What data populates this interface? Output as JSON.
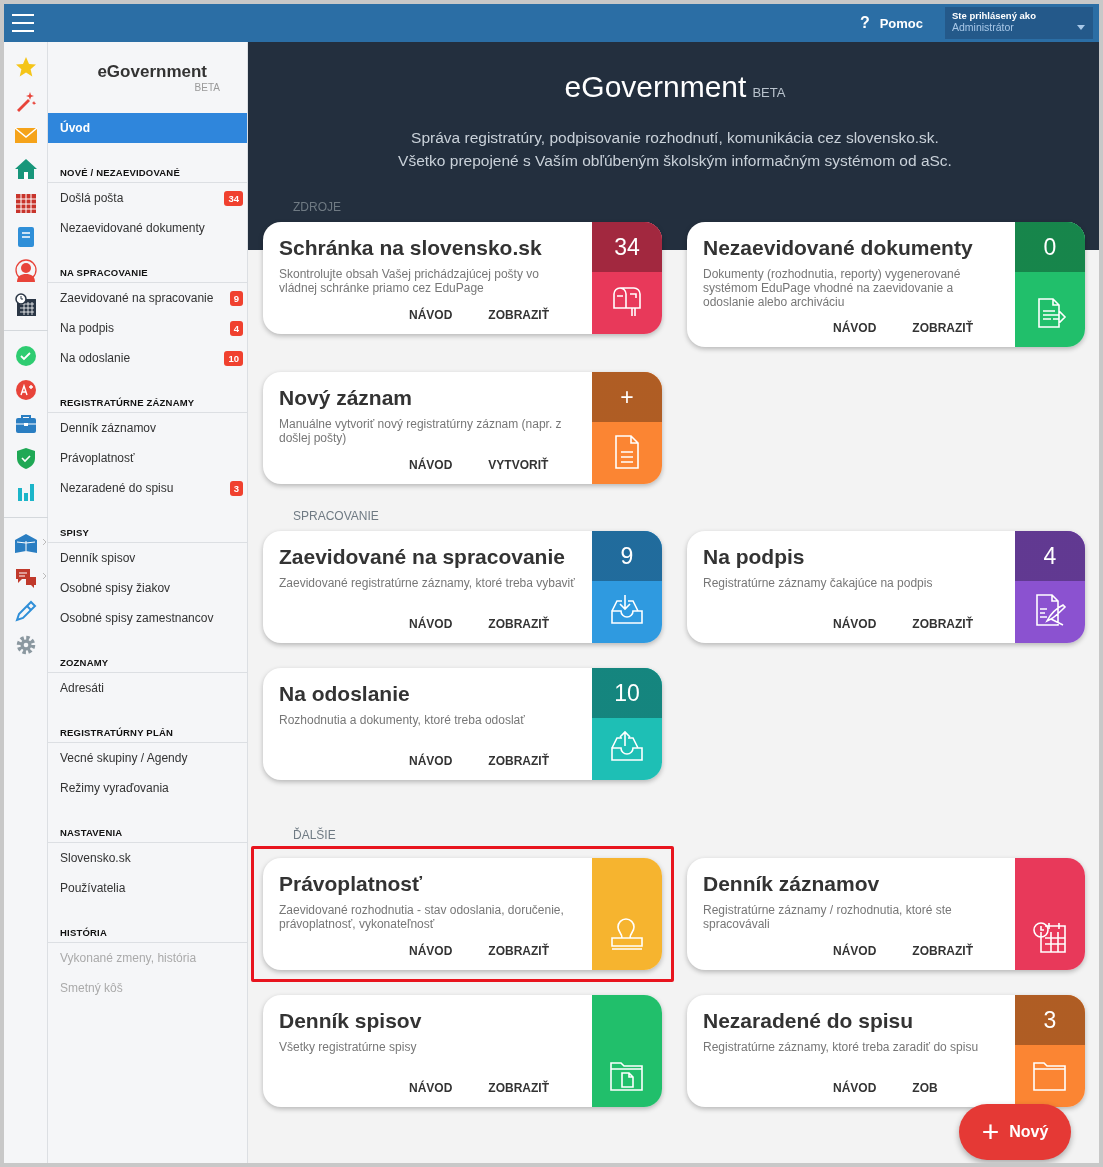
{
  "top_bar": {
    "help": {
      "icon": "?",
      "label": "Pomoc"
    },
    "user": {
      "caption": "Ste prihlásený ako",
      "name": "Administrátor"
    }
  },
  "sidebar": {
    "brand": "eGovernment",
    "brand_tag": "BETA",
    "home": {
      "label": "Úvod",
      "selected": true
    },
    "groups": [
      {
        "title": "NOVÉ / NEZAEVIDOVANÉ",
        "items": [
          {
            "label": "Došlá pošta",
            "badge": "34",
            "disabled": false
          },
          {
            "label": "Nezaevidované dokumenty",
            "disabled": false
          }
        ]
      },
      {
        "title": "NA SPRACOVANIE",
        "items": [
          {
            "label": "Zaevidované na spracovanie",
            "badge": "9",
            "disabled": false
          },
          {
            "label": "Na podpis",
            "badge": "4",
            "disabled": false
          },
          {
            "label": "Na odoslanie",
            "badge": "10",
            "disabled": false
          }
        ]
      },
      {
        "title": "REGISTRATÚRNE ZÁZNAMY",
        "items": [
          {
            "label": "Denník záznamov",
            "disabled": false
          },
          {
            "label": "Právoplatnosť",
            "disabled": false
          },
          {
            "label": "Nezaradené do spisu",
            "badge": "3",
            "disabled": false
          }
        ]
      },
      {
        "title": "SPISY",
        "items": [
          {
            "label": "Denník spisov",
            "disabled": false
          },
          {
            "label": "Osobné spisy žiakov",
            "disabled": false
          },
          {
            "label": "Osobné spisy zamestnancov",
            "disabled": false
          }
        ]
      },
      {
        "title": "ZOZNAMY",
        "items": [
          {
            "label": "Adresáti",
            "disabled": false
          }
        ]
      },
      {
        "title": "REGISTRATÚRNY PLÁN",
        "items": [
          {
            "label": "Vecné skupiny / Agendy",
            "disabled": false
          },
          {
            "label": "Režimy vyraďovania",
            "disabled": false
          }
        ]
      },
      {
        "title": "NASTAVENIA",
        "items": [
          {
            "label": "Slovensko.sk",
            "disabled": false
          },
          {
            "label": "Používatelia",
            "disabled": false
          }
        ]
      },
      {
        "title": "HISTÓRIA",
        "items": [
          {
            "label": "Vykonané zmeny, história",
            "disabled": true
          },
          {
            "label": "Smetný kôš",
            "disabled": true
          }
        ]
      }
    ]
  },
  "hero": {
    "title": "eGovernment",
    "tag": "BETA",
    "lines": [
      "Správa registratúry, podpisovanie rozhodnutí, komunikácia cez slovensko.sk.",
      "Všetko prepojené s Vaším obľúbeným školským informačným systémom od aSc."
    ]
  },
  "sections": [
    {
      "label": "ZDROJE",
      "rows": [
        [
          {
            "title": "Schránka na slovensko.sk",
            "description": "Skontrolujte obsah Vašej prichádzajúcej pošty vo vládnej schránke priamo cez EduPage",
            "actions": [
              "NÁVOD",
              "ZOBRAZIŤ"
            ],
            "count": "34",
            "color": "#e8395a",
            "highlighted": false
          },
          {
            "title": "Nezaevidované dokumenty",
            "description": "Dokumenty (rozhodnutia, reporty) vygenerované systémom EduPage vhodné na zaevidovanie a odoslanie alebo archiváciu",
            "actions": [
              "NÁVOD",
              "ZOBRAZIŤ"
            ],
            "count": "0",
            "color": "#21bf6b",
            "highlighted": false
          }
        ],
        [
          {
            "title": "Nový záznam",
            "description": "Manuálne vytvoriť nový registratúrny záznam (napr. z došlej pošty)",
            "actions": [
              "NÁVOD",
              "VYTVORIŤ"
            ],
            "count": "+",
            "color": "#fb8533",
            "highlighted": false
          }
        ]
      ]
    },
    {
      "label": "SPRACOVANIE",
      "rows": [
        [
          {
            "title": "Zaevidované na spracovanie",
            "description": "Zaevidované registratúrne záznamy, ktoré treba vybaviť",
            "actions": [
              "NÁVOD",
              "ZOBRAZIŤ"
            ],
            "count": "9",
            "color": "#2f9ae0",
            "highlighted": false
          },
          {
            "title": "Na podpis",
            "description": "Registratúrne záznamy čakajúce na podpis",
            "actions": [
              "NÁVOD",
              "ZOBRAZIŤ"
            ],
            "count": "4",
            "color": "#8b52d0",
            "highlighted": false
          }
        ],
        [
          {
            "title": "Na odoslanie",
            "description": "Rozhodnutia a dokumenty, ktoré treba odoslať",
            "actions": [
              "NÁVOD",
              "ZOBRAZIŤ"
            ],
            "count": "10",
            "color": "#1ebfb5",
            "highlighted": false
          }
        ]
      ]
    },
    {
      "label": "ĎALŠIE",
      "rows": [
        [
          {
            "title": "Právoplatnosť",
            "description": "Zaevidované rozhodnutia - stav odoslania, doručenie, právoplatnosť, vykonateľnosť",
            "actions": [
              "NÁVOD",
              "ZOBRAZIŤ"
            ],
            "color": "#f6b42f",
            "highlighted": true
          },
          {
            "title": "Denník záznamov",
            "description": "Registratúrne záznamy / rozhodnutia, ktoré ste spracovávali",
            "actions": [
              "NÁVOD",
              "ZOBRAZIŤ"
            ],
            "color": "#e8395a",
            "highlighted": false
          }
        ],
        [
          {
            "title": "Denník spisov",
            "description": "Všetky registratúrne spisy",
            "actions": [
              "NÁVOD",
              "ZOBRAZIŤ"
            ],
            "color": "#21bf6b",
            "highlighted": false
          },
          {
            "title": "Nezaradené do spisu",
            "description": "Registratúrne záznamy, ktoré treba zaradiť do spisu",
            "actions": [
              "NÁVOD",
              "ZOB"
            ],
            "count": "3",
            "color": "#fb8533",
            "highlighted": false
          }
        ]
      ]
    }
  ],
  "fab": {
    "icon": "+",
    "label": "Nový"
  }
}
